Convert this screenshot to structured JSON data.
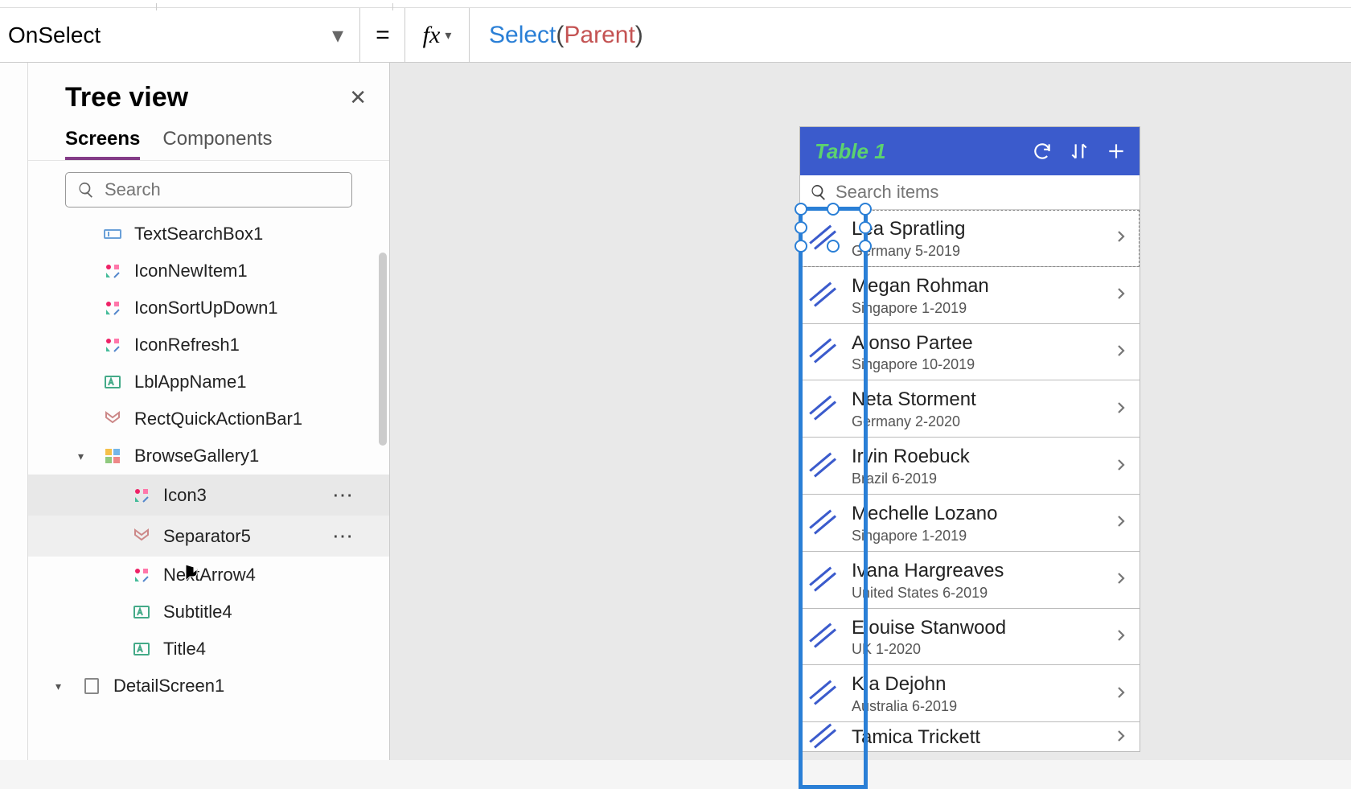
{
  "formula": {
    "property": "OnSelect",
    "fx_label": "fx",
    "equals": "=",
    "func": "Select",
    "open": "(",
    "arg": "Parent",
    "close": ")"
  },
  "tree": {
    "title": "Tree view",
    "tabs": {
      "screens": "Screens",
      "components": "Components"
    },
    "search_placeholder": "Search",
    "items": [
      {
        "label": "TextSearchBox1",
        "icon": "text-input"
      },
      {
        "label": "IconNewItem1",
        "icon": "icon-grp"
      },
      {
        "label": "IconSortUpDown1",
        "icon": "icon-grp"
      },
      {
        "label": "IconRefresh1",
        "icon": "icon-grp"
      },
      {
        "label": "LblAppName1",
        "icon": "label"
      },
      {
        "label": "RectQuickActionBar1",
        "icon": "shape"
      },
      {
        "label": "BrowseGallery1",
        "icon": "gallery",
        "expand": true
      },
      {
        "label": "Icon3",
        "icon": "icon-grp",
        "depth": 2,
        "state": "selected",
        "more": true
      },
      {
        "label": "Separator5",
        "icon": "shape",
        "depth": 2,
        "state": "hovered",
        "more": true
      },
      {
        "label": "NextArrow4",
        "icon": "icon-grp",
        "depth": 2
      },
      {
        "label": "Subtitle4",
        "icon": "label",
        "depth": 2
      },
      {
        "label": "Title4",
        "icon": "label",
        "depth": 2
      },
      {
        "label": "DetailScreen1",
        "icon": "screen",
        "depth": 0,
        "expand": true
      }
    ]
  },
  "phone": {
    "title": "Table 1",
    "search_placeholder": "Search items",
    "rows": [
      {
        "name": "Lea Spratling",
        "sub": "Germany 5-2019"
      },
      {
        "name": "Megan Rohman",
        "sub": "Singapore 1-2019"
      },
      {
        "name": "Alonso Partee",
        "sub": "Singapore 10-2019"
      },
      {
        "name": "Neta Storment",
        "sub": "Germany 2-2020"
      },
      {
        "name": "Irvin Roebuck",
        "sub": "Brazil 6-2019"
      },
      {
        "name": "Mechelle Lozano",
        "sub": "Singapore 1-2019"
      },
      {
        "name": "Ivana Hargreaves",
        "sub": "United States 6-2019"
      },
      {
        "name": "Elouise Stanwood",
        "sub": "UK 1-2020"
      },
      {
        "name": "Kia Dejohn",
        "sub": "Australia 6-2019"
      },
      {
        "name": "Tamica Trickett",
        "sub": "",
        "partial": true
      }
    ]
  }
}
